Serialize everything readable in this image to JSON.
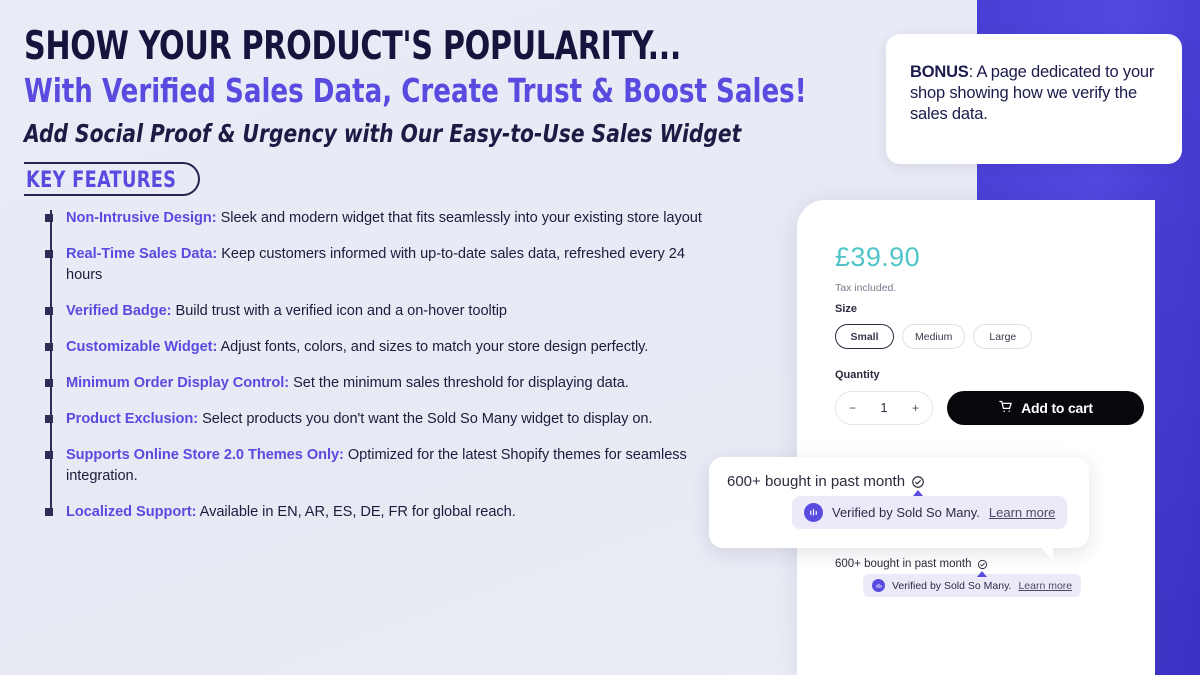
{
  "theme": {
    "background": "#e9ecf7",
    "accent_purple": "#5a4be0",
    "band_purple": "#4a3fd4",
    "dark_navy": "#14143c",
    "price_teal": "#51c4ca",
    "tooltip_bg": "#eceaf9"
  },
  "hero": {
    "heading_line1": "SHOW YOUR PRODUCT'S POPULARITY...",
    "heading_line2": "With Verified Sales Data, Create Trust & Boost Sales!",
    "subheading": "Add Social Proof & Urgency with Our Easy-to-Use Sales Widget",
    "key_features_label": "KEY FEATURES"
  },
  "features": [
    {
      "term": "Non-Intrusive Design:",
      "text": " Sleek and modern widget that fits seamlessly into your existing store layout"
    },
    {
      "term": "Real-Time Sales Data:",
      "text": " Keep customers informed with up-to-date sales data, refreshed every 24 hours"
    },
    {
      "term": "Verified Badge:",
      "text": " Build trust with a verified icon and a on-hover tooltip"
    },
    {
      "term": "Customizable Widget:",
      "text": " Adjust fonts, colors, and sizes to match your store design perfectly."
    },
    {
      "term": "Minimum Order Display Control:",
      "text": " Set the minimum sales threshold for displaying data."
    },
    {
      "term": "Product Exclusion:",
      "text": " Select products you don't want the Sold So Many widget to display on."
    },
    {
      "term": "Supports Online Store 2.0 Themes Only:",
      "text": " Optimized for the latest Shopify themes for seamless integration."
    },
    {
      "term": "Localized Support:",
      "text": " Available in EN, AR, ES, DE, FR for global reach."
    }
  ],
  "bonus": {
    "label": "BONUS",
    "text": ": A page dedicated to your shop showing how we verify the sales data."
  },
  "product": {
    "price": "£39.90",
    "tax_note": "Tax included.",
    "size_label": "Size",
    "sizes": [
      {
        "label": "Small",
        "selected": true
      },
      {
        "label": "Medium",
        "selected": false
      },
      {
        "label": "Large",
        "selected": false
      }
    ],
    "quantity_label": "Quantity",
    "quantity_minus": "−",
    "quantity_value": "1",
    "quantity_plus": "+",
    "add_to_cart_label": "Add to cart"
  },
  "widget": {
    "bought_text": "600+ bought in past month",
    "verified_text": "Verified by Sold So Many.",
    "learn_more": "Learn more"
  }
}
